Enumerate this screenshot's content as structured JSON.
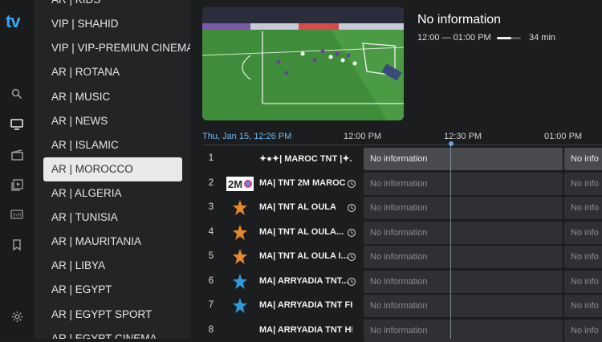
{
  "app": {
    "logo_text": "tv"
  },
  "rail": {
    "icons": [
      "search-icon",
      "tv-icon",
      "movie-icon",
      "play-library-icon",
      "dvr-icon",
      "bookmark-icon",
      "settings-icon"
    ]
  },
  "categories": [
    {
      "label": "AR | KIDS"
    },
    {
      "label": "VIP | SHAHID"
    },
    {
      "label": "VIP | VIP-PREMIUN CINEMA"
    },
    {
      "label": "AR | ROTANA"
    },
    {
      "label": "AR | MUSIC"
    },
    {
      "label": "AR | NEWS"
    },
    {
      "label": "AR | ISLAMIC"
    },
    {
      "label": "AR | MOROCCO"
    },
    {
      "label": "AR | ALGERIA"
    },
    {
      "label": "AR | TUNISIA"
    },
    {
      "label": "AR | MAURITANIA"
    },
    {
      "label": "AR | LIBYA"
    },
    {
      "label": "AR | EGYPT"
    },
    {
      "label": "AR | EGYPT SPORT"
    },
    {
      "label": "AR | EGYPT CINEMA"
    }
  ],
  "selected_category": "AR | MOROCCO",
  "now_playing": {
    "title": "No information",
    "time_range": "12:00 — 01:00 PM",
    "progress": 0.6,
    "duration": "34 min"
  },
  "timeline": {
    "date": "Thu, Jan 15, 12:26 PM",
    "times": [
      "12:00 PM",
      "12:30 PM",
      "01:00 PM"
    ]
  },
  "channels": [
    {
      "num": "1",
      "name": "✦●✦| MAROC TNT |✦...",
      "logo": "",
      "program": "No information",
      "next": "No info",
      "active": true,
      "history": false
    },
    {
      "num": "2",
      "name": "MA| TNT 2M MAROC",
      "logo": "2M",
      "program": "No information",
      "next": "No info",
      "active": false,
      "history": true
    },
    {
      "num": "3",
      "name": "MA| TNT AL OULA",
      "logo": "star",
      "program": "No information",
      "next": "No info",
      "active": false,
      "history": true
    },
    {
      "num": "4",
      "name": "MA| TNT AL OULA...",
      "logo": "star",
      "program": "No information",
      "next": "No info",
      "active": false,
      "history": true
    },
    {
      "num": "5",
      "name": "MA| TNT AL OULA I...",
      "logo": "star",
      "program": "No information",
      "next": "No info",
      "active": false,
      "history": true
    },
    {
      "num": "6",
      "name": "MA| ARRYADIA TNT...",
      "logo": "bluestar",
      "program": "No information",
      "next": "No info",
      "active": false,
      "history": true
    },
    {
      "num": "7",
      "name": "MA| ARRYADIA TNT FHD",
      "logo": "bluestar",
      "program": "No information",
      "next": "No info",
      "active": false,
      "history": false
    },
    {
      "num": "8",
      "name": "MA| ARRYADIA TNT HE...",
      "logo": "",
      "program": "No information",
      "next": "No info",
      "active": false,
      "history": false
    }
  ],
  "colors": {
    "accent": "#3aa6f0",
    "selected_bg": "#e9e9e9",
    "program_bg": "#2f3033",
    "active_program_bg": "#4a4b4e"
  }
}
